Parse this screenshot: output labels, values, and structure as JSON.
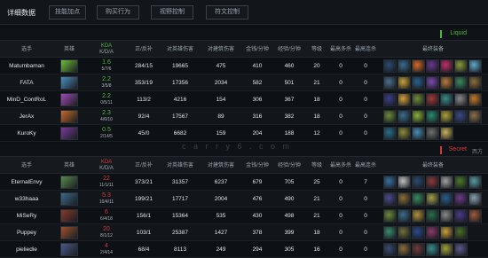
{
  "header": {
    "title": "详细数据",
    "tabs": [
      "技能加点",
      "购买行为",
      "视野控制",
      "符文控制"
    ]
  },
  "watermark": "c a r r y 6 . c o m",
  "columns": [
    "选手",
    "英雄",
    "KDA",
    "K/D/A",
    "正/反补",
    "对英雄伤害",
    "对建筑伤害",
    "金钱/分钟",
    "经验/分钟",
    "等级",
    "最高多杀",
    "最高连杀",
    "最终装备"
  ],
  "teams": [
    {
      "name": "Liquid",
      "color": "#4ab83a",
      "players": [
        {
          "name": "Matumbaman",
          "kda_ratio": "1.6",
          "kda_detail": "5/7/6",
          "cs": "284/15",
          "hero_dmg": "19665",
          "tower_dmg": "475",
          "gpm": "410",
          "xpm": "460",
          "level": "20",
          "multikill": "0",
          "streak": "0",
          "hero_color": "#6fbf3a",
          "items": [
            "#2d4b6e",
            "#3b6b8f",
            "#d06b2a",
            "#6a3a8f",
            "#c0306b",
            "#8a9a3a",
            "#5fa8c8"
          ]
        },
        {
          "name": "FATA",
          "kda_ratio": "2.2",
          "kda_detail": "3/5/8",
          "cs": "353/19",
          "hero_dmg": "17356",
          "tower_dmg": "2034",
          "gpm": "582",
          "xpm": "501",
          "level": "21",
          "multikill": "0",
          "streak": "0",
          "hero_color": "#4a8fbf",
          "items": [
            "#4b6e8a",
            "#c9a13a",
            "#2a5f8a",
            "#7a4bb0",
            "#b87a3a",
            "#3a8a5f",
            "#8a6f3a"
          ]
        },
        {
          "name": "MinD_ContRoL",
          "kda_ratio": "2.2",
          "kda_detail": "0/5/11",
          "cs": "113/2",
          "hero_dmg": "4216",
          "tower_dmg": "154",
          "gpm": "306",
          "xpm": "367",
          "level": "18",
          "multikill": "0",
          "streak": "0",
          "hero_color": "#a04ab8",
          "items": [
            "#3a3f8a",
            "#d0a03a",
            "#6e8a3a",
            "#a03a3a",
            "#3a8a8a",
            "#8a8a8a",
            "#c07a2a"
          ]
        },
        {
          "name": "JerAx",
          "kda_ratio": "2.3",
          "kda_detail": "4/6/10",
          "cs": "92/4",
          "hero_dmg": "17567",
          "tower_dmg": "89",
          "gpm": "316",
          "xpm": "382",
          "level": "18",
          "multikill": "0",
          "streak": "0",
          "hero_color": "#c86a2a",
          "items": [
            "#6e8a3a",
            "#3a6e8a",
            "#8ab03a",
            "#2a8a6e",
            "#b0a03a",
            "#3a4b8a",
            "#8a6e4b"
          ]
        },
        {
          "name": "KuroKy",
          "kda_ratio": "0.5",
          "kda_detail": "2/14/5",
          "cs": "45/0",
          "hero_dmg": "6682",
          "tower_dmg": "159",
          "gpm": "204",
          "xpm": "188",
          "level": "12",
          "multikill": "0",
          "streak": "0",
          "hero_color": "#7a3a9a",
          "items": [
            "#2a6e8a",
            "#8a8a3a",
            "#4b8ab0",
            "#6e6e6e",
            "#c9b05a"
          ]
        }
      ]
    },
    {
      "name": "Secret",
      "color": "#d23a3a",
      "side": "西方",
      "players": [
        {
          "name": "EternalEnvy",
          "kda_ratio": "22",
          "kda_detail": "11/1/11",
          "cs": "373/21",
          "hero_dmg": "31357",
          "tower_dmg": "6237",
          "gpm": "679",
          "xpm": "705",
          "level": "25",
          "multikill": "0",
          "streak": "7",
          "hero_color": "#5a8a4a",
          "items": [
            "#3a6ea0",
            "#c0c0c0",
            "#2a4b6e",
            "#8a3a3a",
            "#a0a0a0",
            "#4a7a2a",
            "#5a9aa0"
          ]
        },
        {
          "name": "w33haaa",
          "kda_ratio": "5.3",
          "kda_detail": "10/4/11",
          "cs": "199/21",
          "hero_dmg": "17717",
          "tower_dmg": "2004",
          "gpm": "476",
          "xpm": "490",
          "level": "21",
          "multikill": "0",
          "streak": "0",
          "hero_color": "#3a6a8a",
          "items": [
            "#4b4b8a",
            "#8a6e3a",
            "#3a8a5f",
            "#a0a04a",
            "#2a5f8a",
            "#6e3a8a",
            "#8aa0b0"
          ]
        },
        {
          "name": "MiSeRy",
          "kda_ratio": "6",
          "kda_detail": "6/4/18",
          "cs": "156/1",
          "hero_dmg": "15364",
          "tower_dmg": "535",
          "gpm": "430",
          "xpm": "498",
          "level": "21",
          "multikill": "0",
          "streak": "0",
          "hero_color": "#8a3a2a",
          "items": [
            "#6e8a3a",
            "#3a6e8a",
            "#b0903a",
            "#2a6e4b",
            "#8a8a8a",
            "#4b3a8a",
            "#a05a3a"
          ]
        },
        {
          "name": "Puppey",
          "kda_ratio": "20",
          "kda_detail": "8/1/12",
          "cs": "103/1",
          "hero_dmg": "25387",
          "tower_dmg": "1427",
          "gpm": "378",
          "xpm": "399",
          "level": "18",
          "multikill": "0",
          "streak": "0",
          "hero_color": "#a0502a",
          "items": [
            "#3a8a6e",
            "#6e6e3a",
            "#2a4b8a",
            "#8a3a6e",
            "#c9a03a",
            "#4a6e2a"
          ]
        },
        {
          "name": "pieliedie",
          "kda_ratio": "4",
          "kda_detail": "2/4/14",
          "cs": "68/4",
          "hero_dmg": "8113",
          "tower_dmg": "249",
          "gpm": "294",
          "xpm": "305",
          "level": "16",
          "multikill": "0",
          "streak": "0",
          "hero_color": "#4a5a8a",
          "items": [
            "#3a4b6e",
            "#8a6e3a",
            "#6e3a3a",
            "#3a8a8a",
            "#a0a03a",
            "#5a5a8a"
          ]
        }
      ]
    }
  ]
}
